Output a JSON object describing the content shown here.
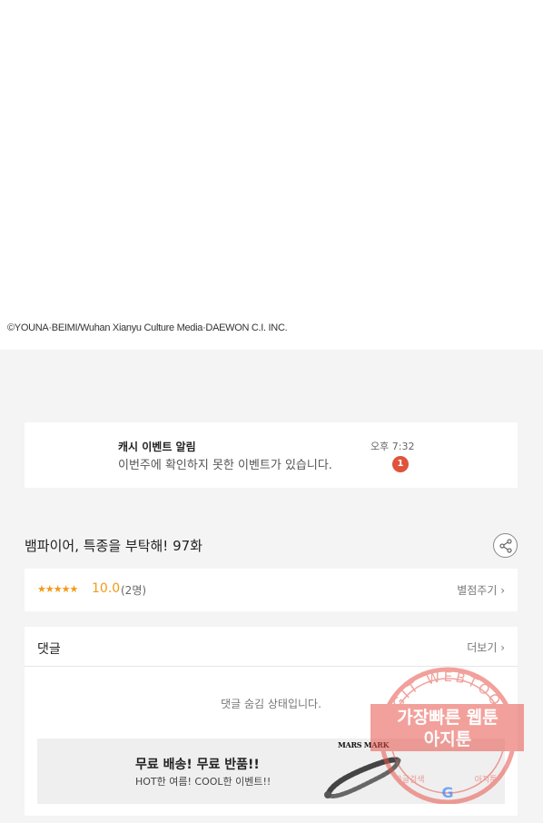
{
  "copyright": "©YOUNA·BEIMI/Wuhan Xianyu Culture Media·DAEWON C.I. INC.",
  "notice": {
    "title": "캐시 이벤트 알림",
    "body": "이번주에 확인하지 못한 이벤트가 있습니다.",
    "time": "오후 7:32",
    "badge": "1"
  },
  "episode": {
    "title": "뱀파이어, 특종을 부탁해! 97화",
    "share_icon": "share-icon"
  },
  "rating": {
    "stars": "★★★★★",
    "score": "10.0",
    "count": "(2명)",
    "link": "별점주기 ›"
  },
  "comments": {
    "title": "댓글",
    "more": "더보기 ›",
    "hidden_text": "댓글 숨김 상태입니다."
  },
  "ad": {
    "title": "무료 배송! 무료 반품!!",
    "subtitle": "HOT한 여름! COOL한 이벤트!!",
    "brand": "MARS MARK"
  },
  "watermark": {
    "arc_text": "AGIT WEBTOON",
    "line1": "가장빠른 웹툰",
    "line2": "아지툰",
    "left_small": "구글검색",
    "right_small": "아지툰",
    "g": "G"
  },
  "colors": {
    "accent_orange": "#f29a18",
    "badge_red": "#e0533a",
    "watermark_red": "#e8534a",
    "background_gray": "#f4f4f4"
  }
}
